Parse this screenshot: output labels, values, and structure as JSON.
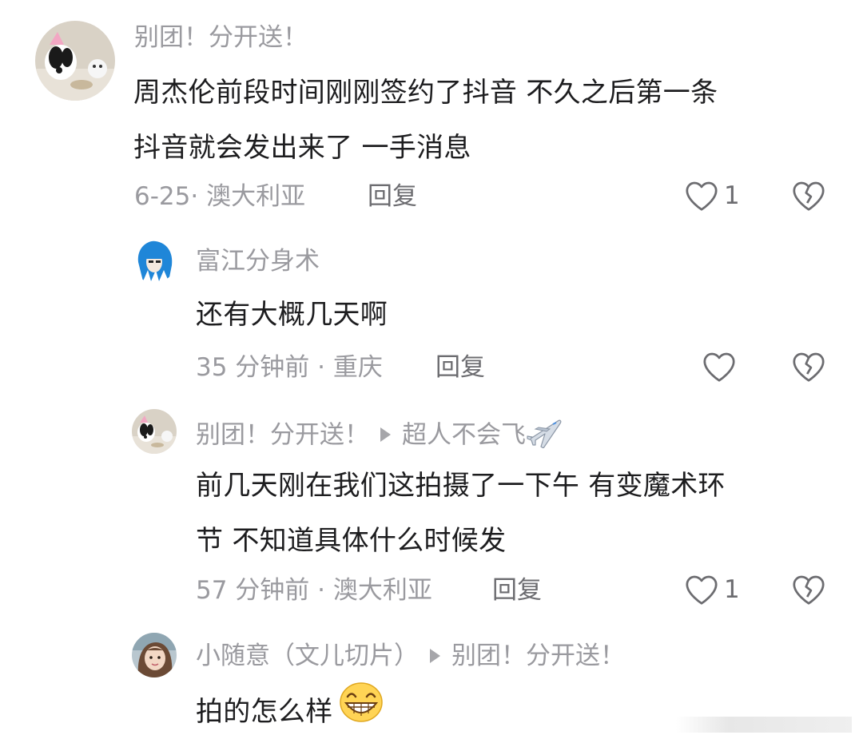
{
  "comments": [
    {
      "username": "别团！分开送！",
      "text_line1": "周杰伦前段时间刚刚签约了抖音 不久之后第一条",
      "text_line2": "抖音就会发出来了 一手消息",
      "meta": "6-25· 澳大利亚",
      "reply_label": "回复",
      "like_count": "1"
    },
    {
      "username": "富江分身术",
      "text_line1": "还有大概几天啊",
      "meta": "35 分钟前 · 重庆",
      "reply_label": "回复"
    },
    {
      "username": "别团！分开送！",
      "reply_to": "超人不会飞",
      "text_line1": "前几天刚在我们这拍摄了一下午 有变魔术环",
      "text_line2": "节 不知道具体什么时候发",
      "meta": "57 分钟前 · 澳大利亚",
      "reply_label": "回复",
      "like_count": "1"
    },
    {
      "username": "小随意（文儿切片）",
      "reply_to": "别团！分开送！",
      "text_line1": "拍的怎么样"
    }
  ],
  "icons": {
    "like": "heart-outline-icon",
    "dislike": "broken-heart-icon",
    "reply_arrow": "triangle-right-icon",
    "emoji_airplane": "airplane-emoji",
    "emoji_grin": "grinning-face-emoji"
  },
  "colors": {
    "text_primary": "#1d1d1f",
    "text_secondary": "#9a9a9f",
    "icon_gray": "#6c6c70"
  }
}
